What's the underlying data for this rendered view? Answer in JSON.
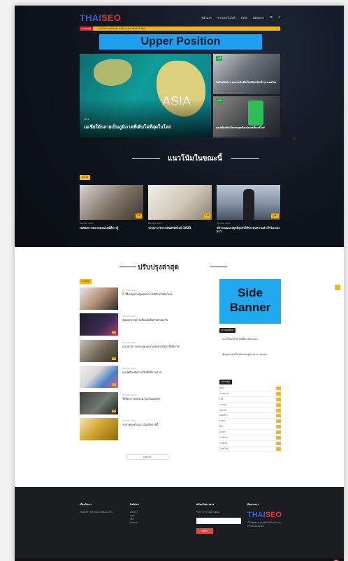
{
  "header": {
    "logo_main": "THAI",
    "logo_accent": "SEO",
    "nav": [
      "หน้าแรก",
      "ข่าวเทคโนโลยี",
      "ธุรกิจ",
      "ติดต่อเรา"
    ],
    "icons": [
      "hamburger-icon",
      "search-icon"
    ]
  },
  "ticker": {
    "tag": "ข่าวล่าสุด",
    "text": "เอเชียใต้กลายเป็นภูมิภาคที่มีการเติบโตดิจิทัลเร็วที่สุด",
    "nav": "‹  ›"
  },
  "top_banner": "Upper Position",
  "hero": {
    "image_text": "ASIA",
    "meta": "ธุรกิจ",
    "title": "เอเชียใต้กลายเป็นภูมิภาคที่เติบโตที่สุดในโลก"
  },
  "side_cards": [
    {
      "badge": "ไอที",
      "title": "นิสสันเปิดตัวระบบช่วยขับขี่อัตโนมัติรุ่นใหม่ในประเทศไทย"
    },
    {
      "badge": "แอป",
      "title": "แอปพลิเคชันเรียกรถยอดนิยมอัปเดตฟีเจอร์ใหม่"
    }
  ],
  "trend_section": {
    "title": "แนวโน้มในขณะนี้",
    "label": "แนะนำ",
    "cards": [
      {
        "badge": "ไอที",
        "meta": "ธันวาคม 2023",
        "title": "เทคนิคการตลาดออนไลน์ที่ควรรู้"
      },
      {
        "badge": "ไอที",
        "meta": "ธันวาคม 2023",
        "title": "ระบบการชำระเงินดิจิทัลในปี 2023"
      },
      {
        "badge": "ธุรกิจ",
        "meta": "ธันวาคม 2023",
        "title": "วิธีวางแผนกลยุทธ์ธุรกิจให้ประสบความสำเร็จในระยะยาว"
      }
    ]
  },
  "latest": {
    "title": "ปรับปรุงล่าสุด",
    "label": "ข่าวใหม่",
    "items": [
      {
        "meta": "ธันวาคม 2023",
        "title": "5 วิธีลงทุนในหุ้นเทคโนโลยีสำหรับมือใหม่",
        "badge": "ไอที"
      },
      {
        "meta": "ธันวาคม 2023",
        "title": "อัปเดตล่าสุดโซเชียลมีเดียสำหรับธุรกิจ",
        "badge": "ไอที"
      },
      {
        "meta": "ธันวาคม 2023",
        "title": "แนวทางการประชุมออนไลน์อย่างมีประสิทธิภาพ",
        "badge": "ไอที"
      },
      {
        "meta": "ธันวาคม 2023",
        "title": "แอปพลิเคชันการเงินที่ใช้งานง่าย",
        "badge": "ไอที"
      },
      {
        "meta": "ธันวาคม 2023",
        "title": "วิธีจัดการงบประมาณส่วนบุคคล",
        "badge": "ไอที"
      },
      {
        "meta": "ธันวาคม 2023",
        "title": "ราคาทองคำแนวโน้มสัปดาห์นี้",
        "badge": "ไอที"
      }
    ],
    "more": "ดูเพิ่มเติม"
  },
  "side_banner": {
    "line1": "Side",
    "line2": "Banner"
  },
  "sidebar": {
    "head1": "ข่าวยอดนิยม",
    "text1": "แนวโน้มเทคโนโลยีที่น่าจับตามอง",
    "text2": "ข้อมูลล่าสุดเกี่ยวกับเศรษฐกิจและการลงทุน",
    "head2": "หมวดหมู่",
    "categories": [
      "ธุรกิจ",
      "การตลาด",
      "ไอที",
      "การเงิน",
      "สุขภาพ",
      "ท่องเที่ยว",
      "อาหาร",
      "กีฬา",
      "บันเทิง",
      "การศึกษา",
      "ยานยนต์",
      "ไลฟ์สไตล์"
    ]
  },
  "footer": {
    "col1": {
      "head": "เกี่ยวกับเรา",
      "text": "เว็บไซต์ข่าวสารเทคโนโลยีและธุรกิจ"
    },
    "col2": {
      "head": "ลิงก์ด่วน",
      "links": [
        "หน้าแรก",
        "ธุรกิจ",
        "ไอที",
        "ติดต่อเรา"
      ]
    },
    "col3": {
      "head": "สมัครรับข่าวสาร",
      "text": "รับข่าวสารล่าสุดผ่านอีเมล",
      "button": "สมัคร"
    },
    "col4": {
      "head": "ติดตามเรา",
      "text": "เว็บไซต์ข่าวสารเทคโนโลยี ธุรกิจ และการตลาดออนไลน์"
    }
  },
  "back_to_top": "^"
}
